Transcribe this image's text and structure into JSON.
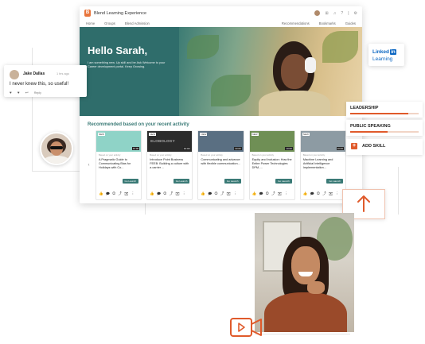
{
  "app": {
    "title": "Blend Learning Experience",
    "logo_letter": "B",
    "nav": {
      "left": [
        "Home",
        "Groups",
        "Blend Admission"
      ],
      "right": [
        "Recommendations",
        "Bookmarks",
        "Guides"
      ]
    },
    "top_icons": [
      "avatar",
      "grid-icon",
      "bell-icon",
      "help-icon",
      "divider",
      "settings-icon"
    ]
  },
  "hero": {
    "greeting": "Hello Sarah,",
    "subtitle": "I am something new. Up skill and be Ask Welcome to your Career development portal. Keep Growing."
  },
  "recommendations": {
    "title": "Recommended based on your recent activity",
    "cards": [
      {
        "badge": "NEW",
        "time": "10:00",
        "meta": "Based on your activity",
        "title": "A Pragmatic Guide to Communicating Bias for Holidays with Co...",
        "button": "Go Launch",
        "thumb_color": "#8fd3c7",
        "thumb_text": ""
      },
      {
        "badge": "NEW",
        "time": "10:00",
        "meta": "Based on your activity",
        "title": "Introduce Point Business FEEB: Building a culture with a carrier ...",
        "button": "Go Launch",
        "thumb_color": "#2b2b2b",
        "thumb_text": "ELOBOLOGY"
      },
      {
        "badge": "NEW",
        "time": "10:00",
        "meta": "Based on your activity",
        "title": "Communicating and advance with flexible communication...",
        "button": "Go Launch",
        "thumb_color": "#5a6f82",
        "thumb_text": ""
      },
      {
        "badge": "NEW",
        "time": "10:00",
        "meta": "Based on your activity",
        "title": "Equity and Inclusion: How the Entire Power Technologies DPM, ...",
        "button": "Go Launch",
        "thumb_color": "#6f8f55",
        "thumb_text": ""
      },
      {
        "badge": "NEW",
        "time": "10:00",
        "meta": "Based on your activity",
        "title": "Machine Learning and Artificial Intelligence Implementation...",
        "button": "Go Launch",
        "thumb_color": "#8d9ba3",
        "thumb_text": ""
      }
    ],
    "card_actions": "👍 🗩 ⊙ ⤴ ✉ ⋮"
  },
  "comment": {
    "name": "Jake Dallas",
    "time": "1 hrs ago",
    "text": "I never knew this, so useful!",
    "actions": "♥ ♥ ↩",
    "reply": "Reply"
  },
  "linkedin": {
    "linked": "Linked",
    "in": "in",
    "learning": "Learning"
  },
  "skills": [
    {
      "label": "LEADERSHIP",
      "level": 0.85
    },
    {
      "label": "PUBLIC SPEAKING",
      "level": 0.55
    }
  ],
  "add_skill": {
    "icon": "+",
    "label": "ADD SKILL"
  },
  "colors": {
    "accent": "#e05a2b",
    "teal": "#3a7a76",
    "hero": "#2f6d6b",
    "linkedin": "#0a66c2"
  }
}
